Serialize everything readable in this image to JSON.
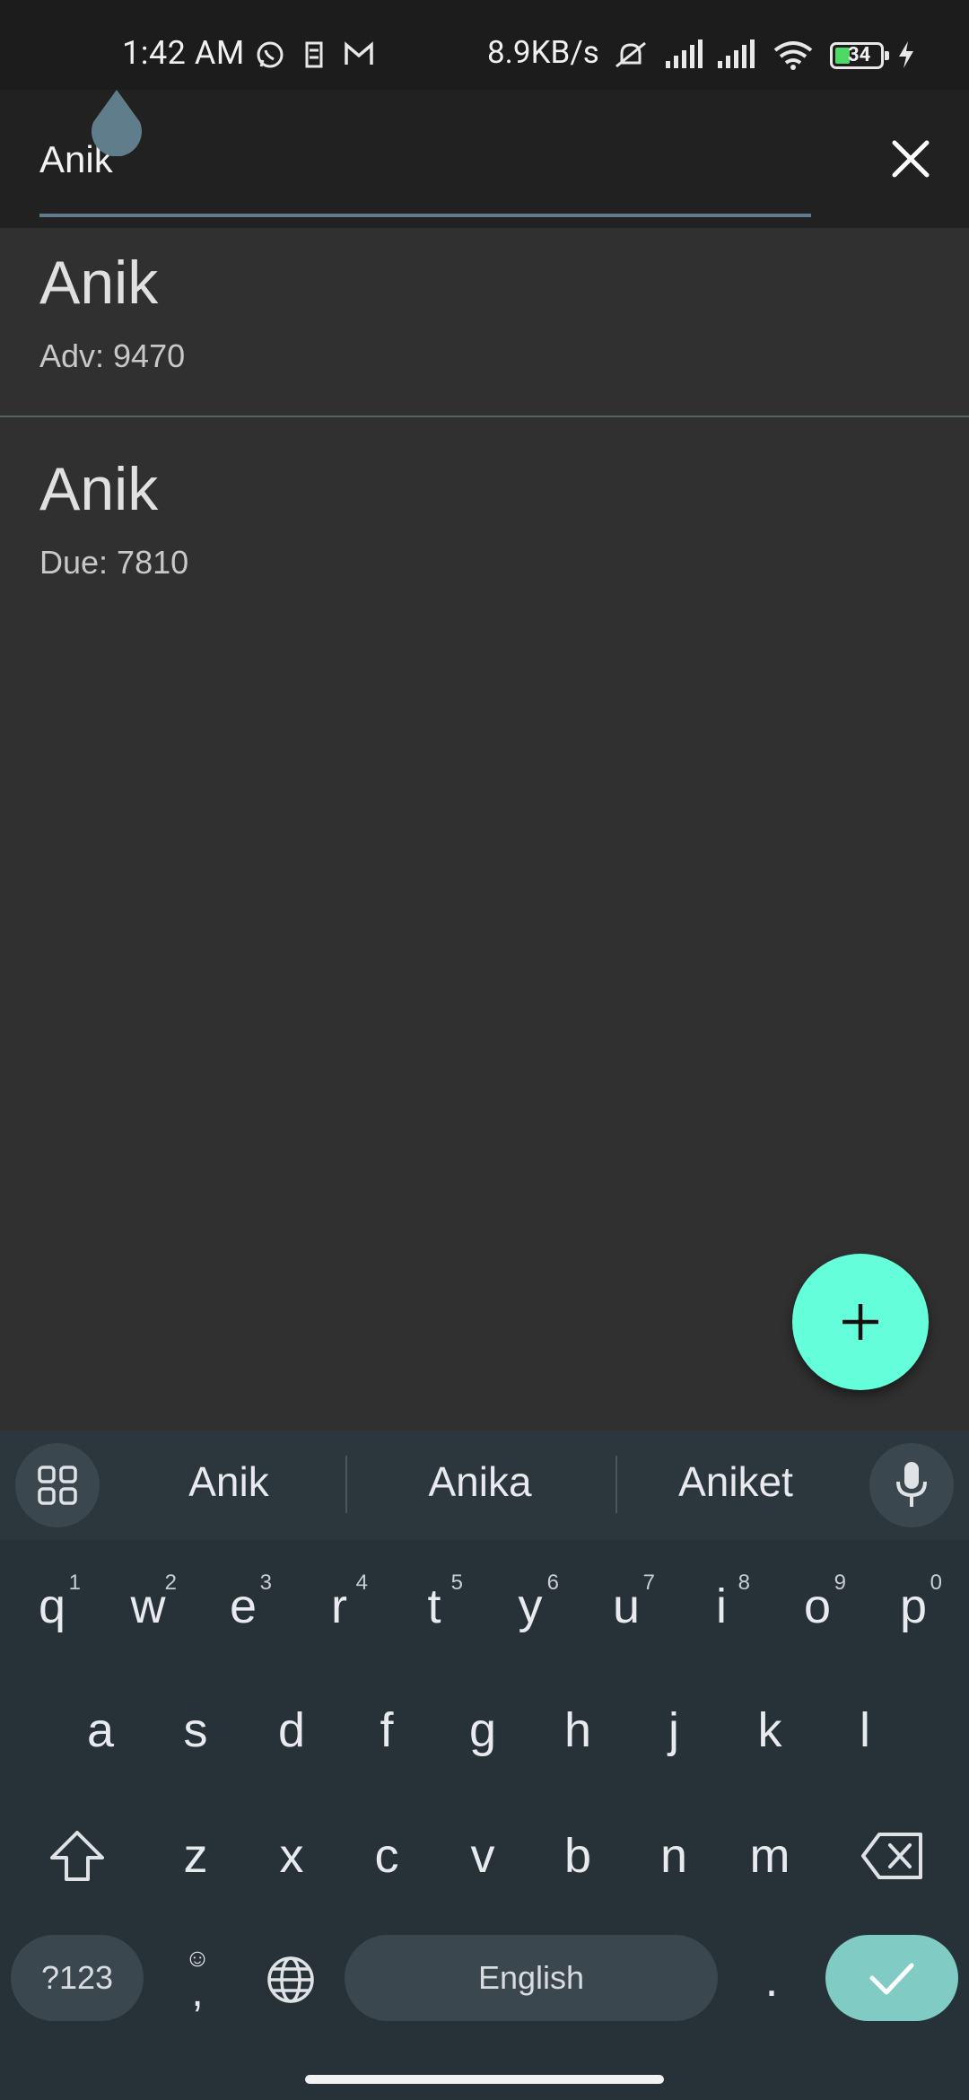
{
  "status_bar": {
    "time": "1:42 AM",
    "net_speed": "8.9KB/s",
    "battery": "34",
    "icons": [
      "whatsapp-icon",
      "app-icon",
      "gmail-icon",
      "mute-icon",
      "signal-icon",
      "signal-icon-2",
      "wifi-icon",
      "charging-icon"
    ]
  },
  "search": {
    "value": "Anik",
    "placeholder": ""
  },
  "results": [
    {
      "name": "Anik",
      "detail": "Adv: 9470"
    },
    {
      "name": "Anik",
      "detail": "Due: 7810"
    }
  ],
  "fab": {
    "icon": "plus-icon"
  },
  "keyboard": {
    "suggestions": [
      "Anik",
      "Anika",
      "Aniket"
    ],
    "row1": [
      "q",
      "w",
      "e",
      "r",
      "t",
      "y",
      "u",
      "i",
      "o",
      "p"
    ],
    "row1_sup": [
      "1",
      "2",
      "3",
      "4",
      "5",
      "6",
      "7",
      "8",
      "9",
      "0"
    ],
    "row2": [
      "a",
      "s",
      "d",
      "f",
      "g",
      "h",
      "j",
      "k",
      "l"
    ],
    "row3": [
      "z",
      "x",
      "c",
      "v",
      "b",
      "n",
      "m"
    ],
    "symbols_label": "?123",
    "space_label": "English",
    "period_label": ".",
    "emoji_comma": ","
  },
  "colors": {
    "accent": "#64ffda",
    "underline": "#607d8b",
    "done": "#80cbc4"
  }
}
